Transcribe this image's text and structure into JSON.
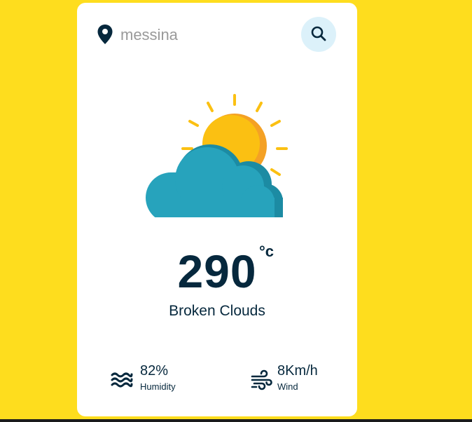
{
  "search": {
    "value": "",
    "placeholder": "messina",
    "location_icon": "map-pin-icon",
    "search_icon": "magnifier-icon"
  },
  "weather": {
    "illustration": "sun-behind-cloud-icon",
    "temperature": "290",
    "unit": "°c",
    "description": "Broken Clouds"
  },
  "details": {
    "humidity": {
      "value": "82%",
      "label": "Humidity",
      "icon": "waves-icon"
    },
    "wind": {
      "value": "8Km/h",
      "label": "Wind",
      "icon": "wind-icon"
    }
  },
  "colors": {
    "background": "#FEDD1E",
    "card": "#FFFFFF",
    "text": "#06283D",
    "search_button": "#DCF1FA",
    "sun": "#FBC012",
    "sun_shadow": "#F4A125",
    "cloud": "#27A3BC",
    "cloud_shadow": "#1C8BA3"
  }
}
